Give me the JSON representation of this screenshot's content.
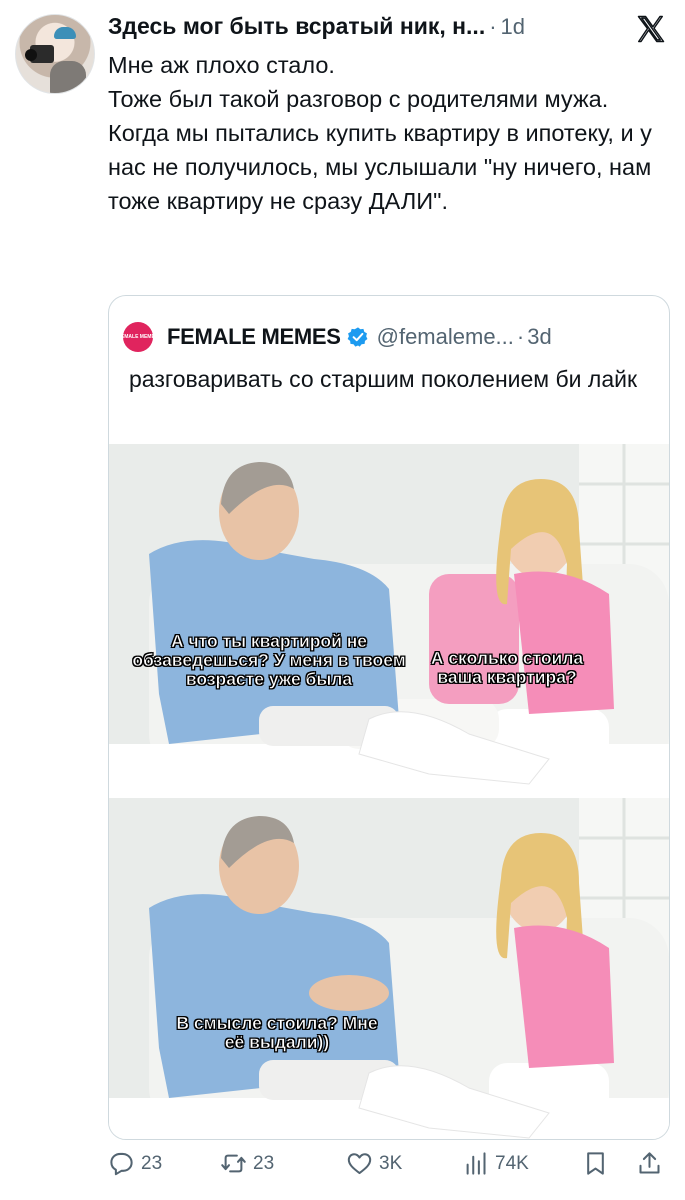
{
  "tweet": {
    "author": "Здесь мог быть всратый ник, н...",
    "time": "1d",
    "paragraphs": [
      "Мне аж плохо стало.",
      "Тоже был такой разговор с родителями мужа.",
      "Когда мы пытались купить квартиру в ипотеку, и у нас не получилось, мы услышали \"ну ничего, нам тоже квартиру не сразу ДАЛИ\"."
    ]
  },
  "quote": {
    "avatar_text": "FEMALE MEMES",
    "name": "FEMALE MEMES",
    "handle": "@femaleme...",
    "time": "3d",
    "text": "разговаривать со старшим поколением би лайк",
    "meme_top": {
      "caption_left": "А что ты квартирой не обзаведешься? У меня в твоем возрасте уже была",
      "caption_right": "А сколько стоила ваша квартира?"
    },
    "meme_bottom": {
      "caption_left": "В смысле стоила? Мне её выдали))"
    }
  },
  "actions": {
    "replies": "23",
    "reposts": "23",
    "likes": "3K",
    "views": "74K"
  },
  "icons": [
    "x-logo-icon",
    "verified-icon",
    "reply-icon",
    "repost-icon",
    "like-icon",
    "views-icon",
    "bookmark-icon",
    "share-icon"
  ],
  "colors": {
    "text": "#0f1419",
    "secondary": "#536471",
    "verified": "#1d9bf0",
    "border": "#cfd9de"
  }
}
